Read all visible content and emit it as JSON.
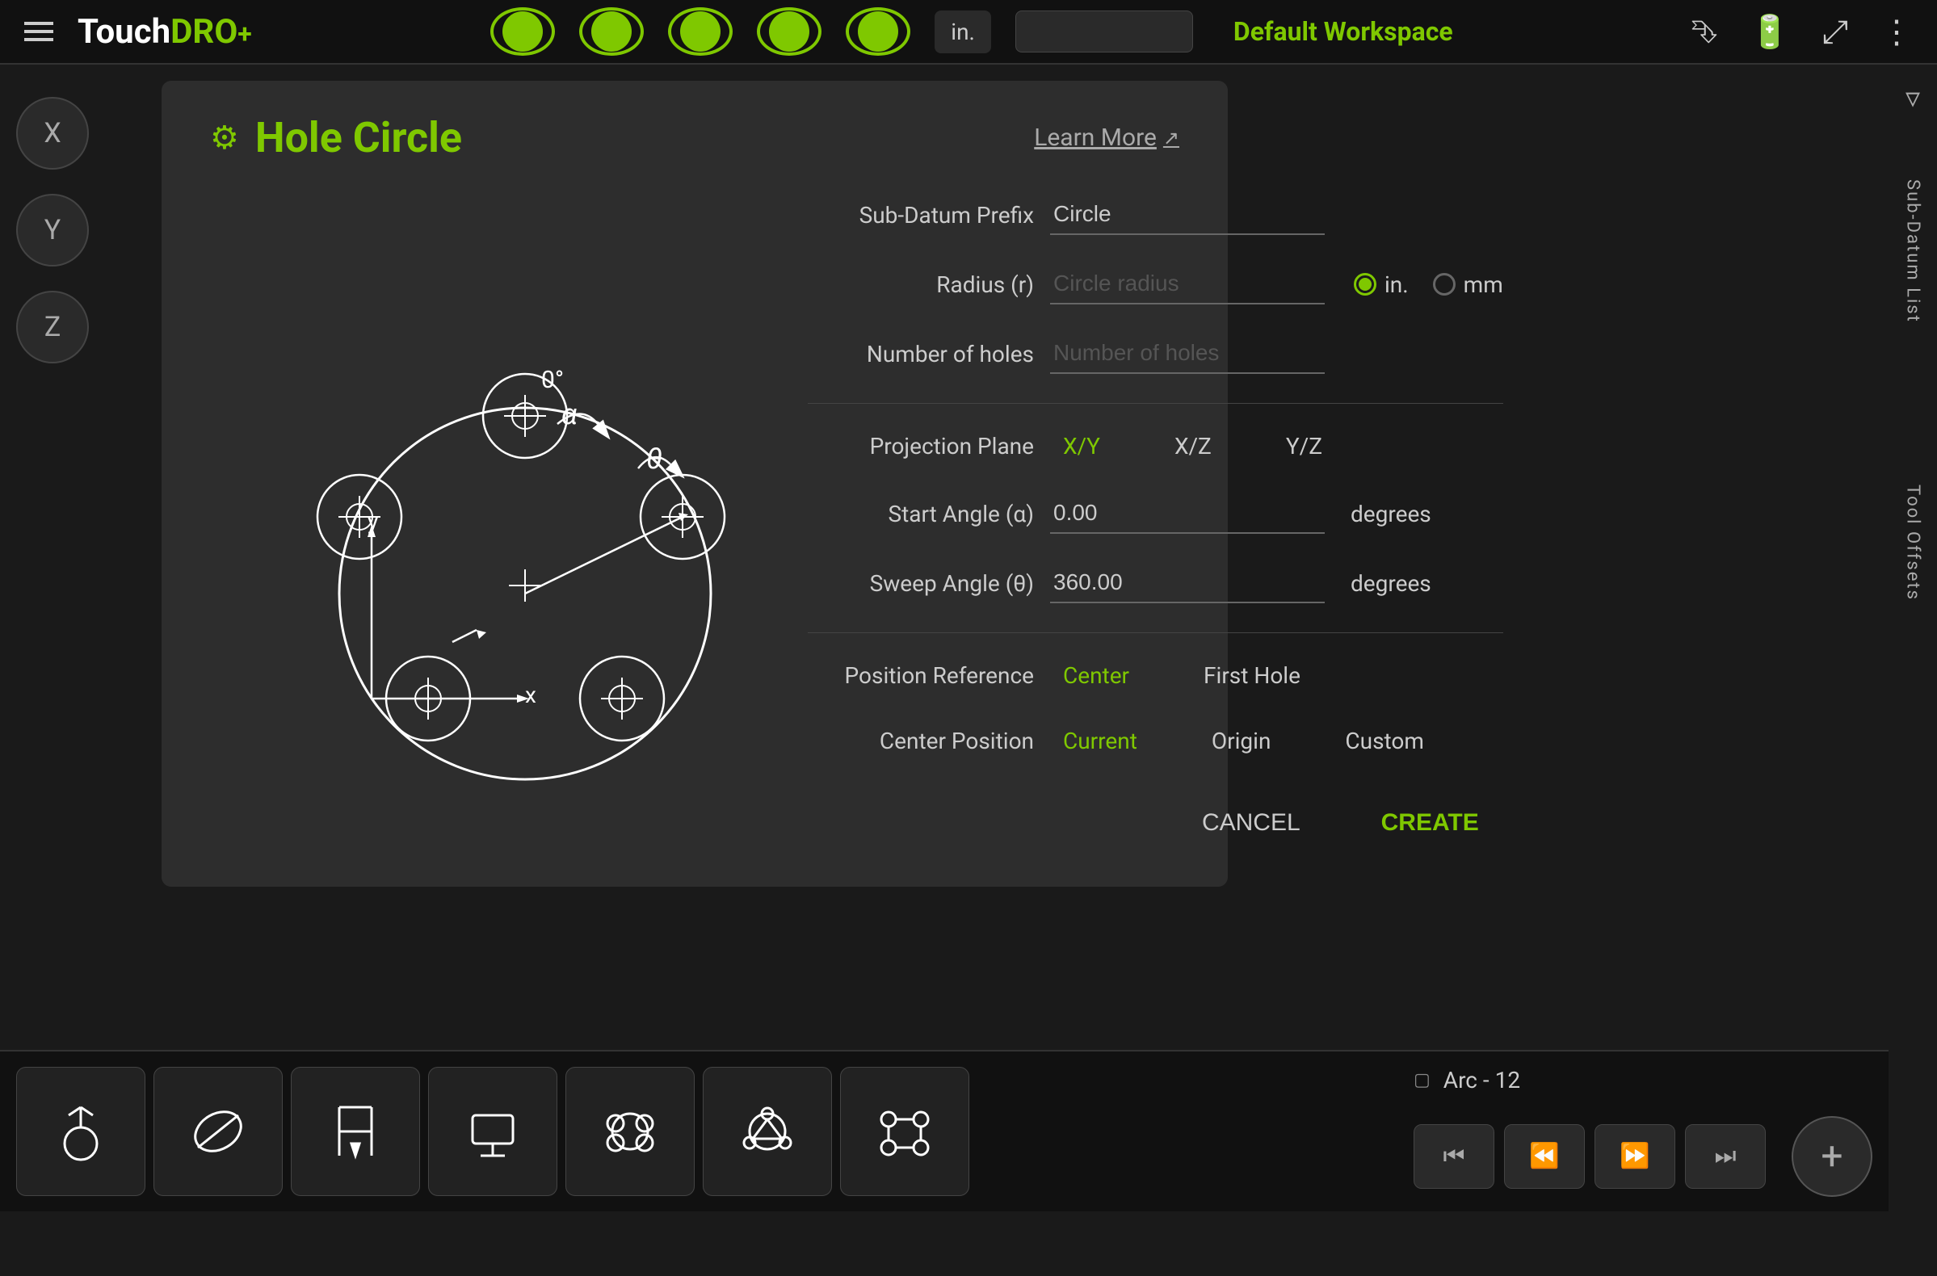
{
  "app": {
    "name": "TouchDRO",
    "name_highlight": "+"
  },
  "topbar": {
    "unit": "in.",
    "workspace": "Default Workspace"
  },
  "axis": {
    "buttons": [
      "X",
      "Y",
      "Z"
    ]
  },
  "right_panel": {
    "label1": "Sub-Datum List",
    "label2": "Tool Offsets"
  },
  "modal": {
    "title": "Hole Circle",
    "gear": "⚙",
    "learn_more": "Learn More",
    "fields": {
      "sub_datum_label": "Sub-Datum Prefix",
      "sub_datum_placeholder": "Circle",
      "radius_label": "Radius (r)",
      "radius_placeholder": "Circle radius",
      "unit_in": "in.",
      "unit_mm": "mm",
      "num_holes_label": "Number of holes",
      "num_holes_placeholder": "Number of holes"
    },
    "projection": {
      "label": "Projection Plane",
      "options": [
        "X/Y",
        "X/Z",
        "Y/Z"
      ],
      "active": "X/Y"
    },
    "angles": {
      "start_label": "Start Angle (α)",
      "start_value": "0.00",
      "start_unit": "degrees",
      "sweep_label": "Sweep Angle (θ)",
      "sweep_value": "360.00",
      "sweep_unit": "degrees"
    },
    "position_ref": {
      "label": "Position Reference",
      "options": [
        "Center",
        "First Hole"
      ],
      "active": "Center"
    },
    "center_pos": {
      "label": "Center Position",
      "options": [
        "Current",
        "Origin",
        "Custom"
      ],
      "active": "Current"
    },
    "buttons": {
      "cancel": "CANCEL",
      "create": "CREATE"
    }
  },
  "bottom": {
    "arc_label": "Arc - 12",
    "nav_buttons": [
      "⏮",
      "⏪",
      "⏩",
      "⏭"
    ],
    "fab": "+"
  }
}
